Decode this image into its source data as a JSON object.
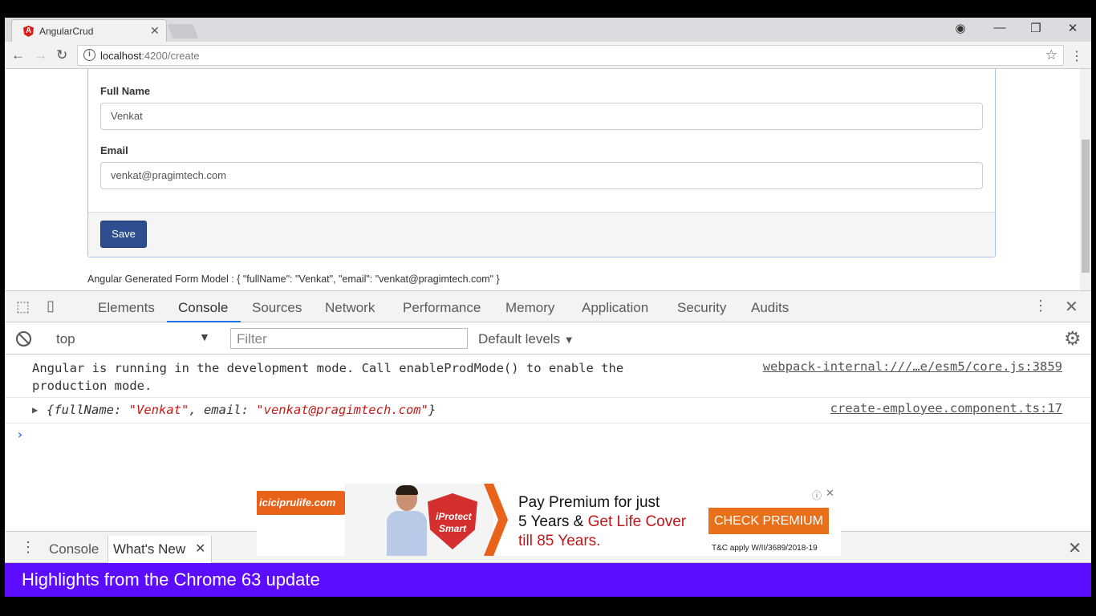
{
  "browser": {
    "tab_title": "AngularCrud",
    "url_host": "localhost",
    "url_path": ":4200/create"
  },
  "form": {
    "fullname_label": "Full Name",
    "fullname_value": "Venkat",
    "email_label": "Email",
    "email_value": "venkat@pragimtech.com",
    "save_label": "Save",
    "model_text": "Angular Generated Form Model : { \"fullName\": \"Venkat\", \"email\": \"venkat@pragimtech.com\" }"
  },
  "devtools": {
    "tabs": [
      "Elements",
      "Console",
      "Sources",
      "Network",
      "Performance",
      "Memory",
      "Application",
      "Security",
      "Audits"
    ],
    "active_tab": "Console",
    "context": "top",
    "filter_placeholder": "Filter",
    "levels": "Default levels",
    "messages": {
      "m1_text": "Angular is running in the development mode. Call enableProdMode() to enable the\nproduction mode.",
      "m1_source": "webpack-internal:///…e/esm5/core.js:3859",
      "m2_obj_open": "{fullName: ",
      "m2_name": "\"Venkat\"",
      "m2_mid": ", email: ",
      "m2_email": "\"venkat@pragimtech.com\"",
      "m2_close": "}",
      "m2_source": "create-employee.component.ts:17"
    },
    "drawer": {
      "console_tab": "Console",
      "whatsnew_tab": "What's New",
      "banner": "Highlights from the Chrome 63 update"
    }
  },
  "ad": {
    "brand": "iciciprulife.com",
    "shield_line1": "iProtect",
    "shield_line2": "Smart",
    "line1": "Pay Premium for just",
    "line2a": "5 Years & ",
    "line2b": "Get Life Cover",
    "line3": "till 85 Years.",
    "cta": "CHECK PREMIUM",
    "fineprint": "T&C apply W/II/3689/2018-19"
  },
  "colors": {
    "accent": "#1a73e8",
    "save_button": "#2e4e8f",
    "banner": "#5c0dff",
    "ad_orange": "#e8701a"
  }
}
